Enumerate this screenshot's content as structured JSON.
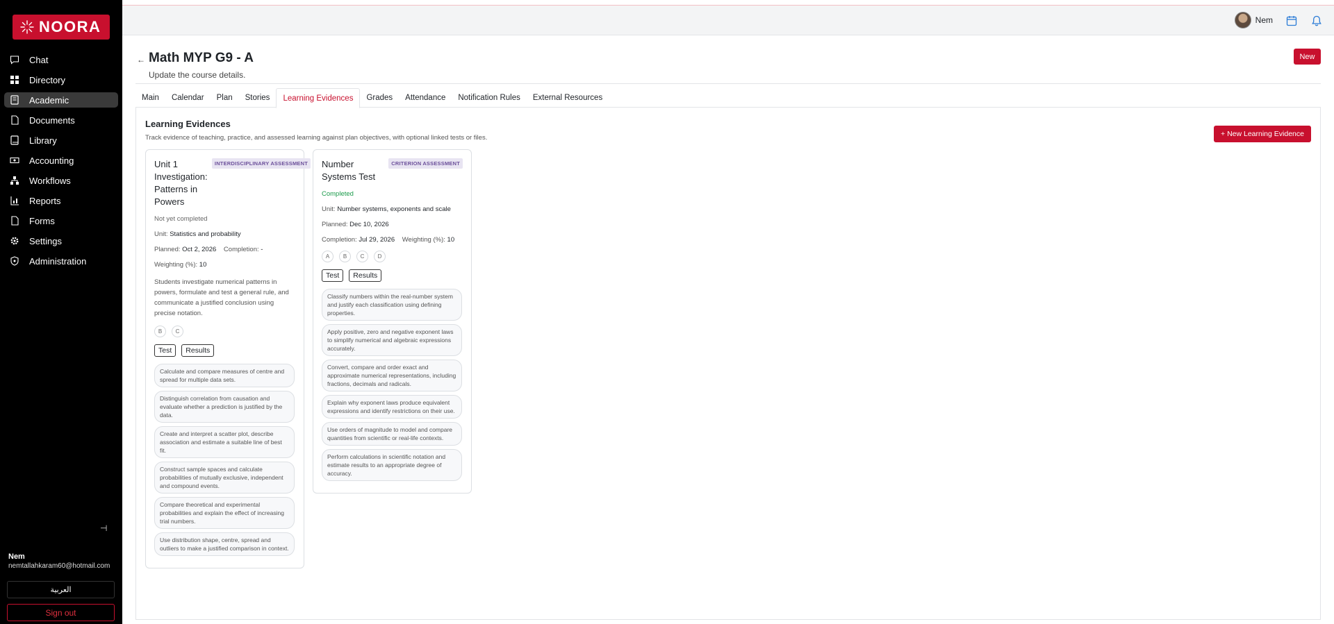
{
  "brand": {
    "name": "NOORA",
    "color": "#c8102e"
  },
  "sidebar": {
    "items": [
      {
        "label": "Chat",
        "icon": "chat-icon"
      },
      {
        "label": "Directory",
        "icon": "grid-icon"
      },
      {
        "label": "Academic",
        "icon": "book-icon",
        "active": true
      },
      {
        "label": "Documents",
        "icon": "document-icon"
      },
      {
        "label": "Library",
        "icon": "library-icon"
      },
      {
        "label": "Accounting",
        "icon": "money-icon"
      },
      {
        "label": "Workflows",
        "icon": "workflow-icon"
      },
      {
        "label": "Reports",
        "icon": "report-icon"
      },
      {
        "label": "Forms",
        "icon": "form-icon"
      },
      {
        "label": "Settings",
        "icon": "gear-icon"
      },
      {
        "label": "Administration",
        "icon": "shield-icon"
      }
    ],
    "user_name": "Nem",
    "user_email": "nemtallahkaram60@hotmail.com",
    "language_button": "العربية",
    "sign_out": "Sign out"
  },
  "topbar": {
    "user_name": "Nem"
  },
  "page": {
    "title": "Math MYP G9 - A",
    "subtitle": "Update the course details.",
    "new_button": "New"
  },
  "tabs": [
    {
      "label": "Main"
    },
    {
      "label": "Calendar"
    },
    {
      "label": "Plan"
    },
    {
      "label": "Stories"
    },
    {
      "label": "Learning Evidences",
      "active": true
    },
    {
      "label": "Grades"
    },
    {
      "label": "Attendance"
    },
    {
      "label": "Notification Rules"
    },
    {
      "label": "External Resources"
    }
  ],
  "evidences": {
    "title": "Learning Evidences",
    "description": "Track evidence of teaching, practice, and assessed learning against plan objectives, with optional linked tests or files.",
    "new_button": "+ New Learning Evidence",
    "cards": [
      {
        "title": "Unit 1 Investigation: Patterns in Powers",
        "badge": "INTERDISCIPLINARY ASSESSMENT",
        "status": "Not yet completed",
        "unit_label": "Unit:",
        "unit": "Statistics and probability",
        "planned_label": "Planned:",
        "planned": "Oct 2, 2026",
        "completion_label": "Completion:",
        "completion": "-",
        "weighting_label": "Weighting (%):",
        "weighting": "10",
        "description": "Students investigate numerical patterns in powers, formulate and test a general rule, and communicate a justified conclusion using precise notation.",
        "criteria": [
          "B",
          "C"
        ],
        "test_button": "Test",
        "results_button": "Results",
        "objectives": [
          "Calculate and compare measures of centre and spread for multiple data sets.",
          "Distinguish correlation from causation and evaluate whether a prediction is justified by the data.",
          "Create and interpret a scatter plot, describe association and estimate a suitable line of best fit.",
          "Construct sample spaces and calculate probabilities of mutually exclusive, independent and compound events.",
          "Compare theoretical and experimental probabilities and explain the effect of increasing trial numbers.",
          "Use distribution shape, centre, spread and outliers to make a justified comparison in context."
        ]
      },
      {
        "title": "Number Systems Test",
        "badge": "CRITERION ASSESSMENT",
        "status": "Completed",
        "unit_label": "Unit:",
        "unit": "Number systems, exponents and scale",
        "planned_label": "Planned:",
        "planned": "Dec 10, 2026",
        "completion_label": "Completion:",
        "completion": "Jul 29, 2026",
        "weighting_label": "Weighting (%):",
        "weighting": "10",
        "criteria": [
          "A",
          "B",
          "C",
          "D"
        ],
        "test_button": "Test",
        "results_button": "Results",
        "objectives": [
          "Classify numbers within the real-number system and justify each classification using defining properties.",
          "Apply positive, zero and negative exponent laws to simplify numerical and algebraic expressions accurately.",
          "Convert, compare and order exact and approximate numerical representations, including fractions, decimals and radicals.",
          "Explain why exponent laws produce equivalent expressions and identify restrictions on their use.",
          "Use orders of magnitude to model and compare quantities from scientific or real-life contexts.",
          "Perform calculations in scientific notation and estimate results to an appropriate degree of accuracy."
        ]
      }
    ]
  }
}
